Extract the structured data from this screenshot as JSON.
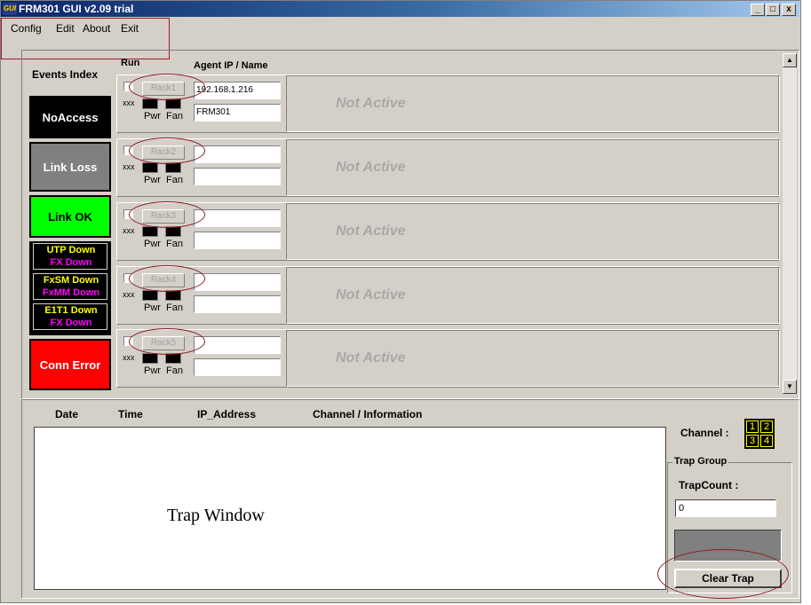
{
  "window": {
    "title": "FRM301  GUI  v2.09  trial",
    "app_icon_text": "GUI",
    "minimize": "_",
    "maximize": "□",
    "close": "x"
  },
  "menu": [
    "Config",
    "Edit",
    "About",
    "Exit"
  ],
  "legend": {
    "header": "Events Index",
    "noaccess": "NoAccess",
    "linkloss": "Link Loss",
    "linkok": "Link OK",
    "multi": [
      {
        "lines": [
          {
            "text": "UTP  Down",
            "color": "#ffff00"
          },
          {
            "text": "FX  Down",
            "color": "#ff00ff"
          }
        ]
      },
      {
        "lines": [
          {
            "text": "FxSM Down",
            "color": "#ffff00"
          },
          {
            "text": "FxMM Down",
            "color": "#ff00ff"
          }
        ]
      },
      {
        "lines": [
          {
            "text": "E1T1 Down",
            "color": "#ffff00"
          },
          {
            "text": "FX  Down",
            "color": "#ff00ff"
          }
        ]
      }
    ],
    "connerror": "Conn Error"
  },
  "columns": {
    "run": "Run",
    "agent": "Agent IP / Name"
  },
  "racks": [
    {
      "button": "Rack1",
      "ip": "192.168.1.216",
      "name": "FRM301",
      "status": "Not Active"
    },
    {
      "button": "Rack2",
      "ip": "",
      "name": "",
      "status": "Not Active"
    },
    {
      "button": "Rack3",
      "ip": "",
      "name": "",
      "status": "Not Active"
    },
    {
      "button": "Rack4",
      "ip": "",
      "name": "",
      "status": "Not Active"
    },
    {
      "button": "Rack5",
      "ip": "",
      "name": "",
      "status": "Not Active"
    }
  ],
  "rack_labels": {
    "xxx": "xxx",
    "pwr": "Pwr",
    "fan": "Fan"
  },
  "trap_headers": {
    "date": "Date",
    "time": "Time",
    "ip": "IP_Address",
    "info": "Channel  /  Information"
  },
  "trap_window_label": "Trap Window",
  "channel": {
    "label": "Channel :",
    "numbers": [
      "1",
      "2",
      "3",
      "4"
    ]
  },
  "trap_group": {
    "title": "Trap Group",
    "count_label": "TrapCount :",
    "count_value": "0",
    "clear_button": "Clear Trap"
  },
  "colors": {
    "annotation": "#8a1a24",
    "noaccess": "#000000",
    "linkloss": "#808080",
    "linkok": "#00ff00",
    "connerror": "#ff0000"
  }
}
